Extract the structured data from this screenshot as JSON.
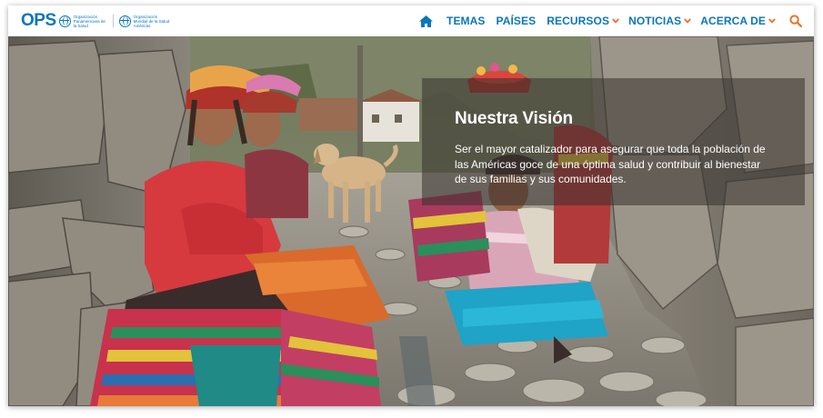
{
  "brand": {
    "logo_text": "OPS",
    "org_line_1": "Organización Panamericana de la Salud",
    "org_line_2": "Organización Mundial de la Salud",
    "org_line_3": "Américas",
    "logo_color": "#0a76bd"
  },
  "nav": {
    "home_icon": "home-icon",
    "items": [
      {
        "label": "TEMAS",
        "dropdown": false
      },
      {
        "label": "PAÍSES",
        "dropdown": false
      },
      {
        "label": "RECURSOS",
        "dropdown": true
      },
      {
        "label": "NOTICIAS",
        "dropdown": true
      },
      {
        "label": "ACERCA DE",
        "dropdown": true
      }
    ],
    "search_icon": "search-icon",
    "text_color": "#0a76bd",
    "accent_color": "#e8732a"
  },
  "hero": {
    "title": "Nuestra Visión",
    "text": "Ser el mayor catalizador para asegurar que toda la población de las Américas goce de una óptima salud y contribuir al bienestar de sus familias y sus comunidades."
  }
}
